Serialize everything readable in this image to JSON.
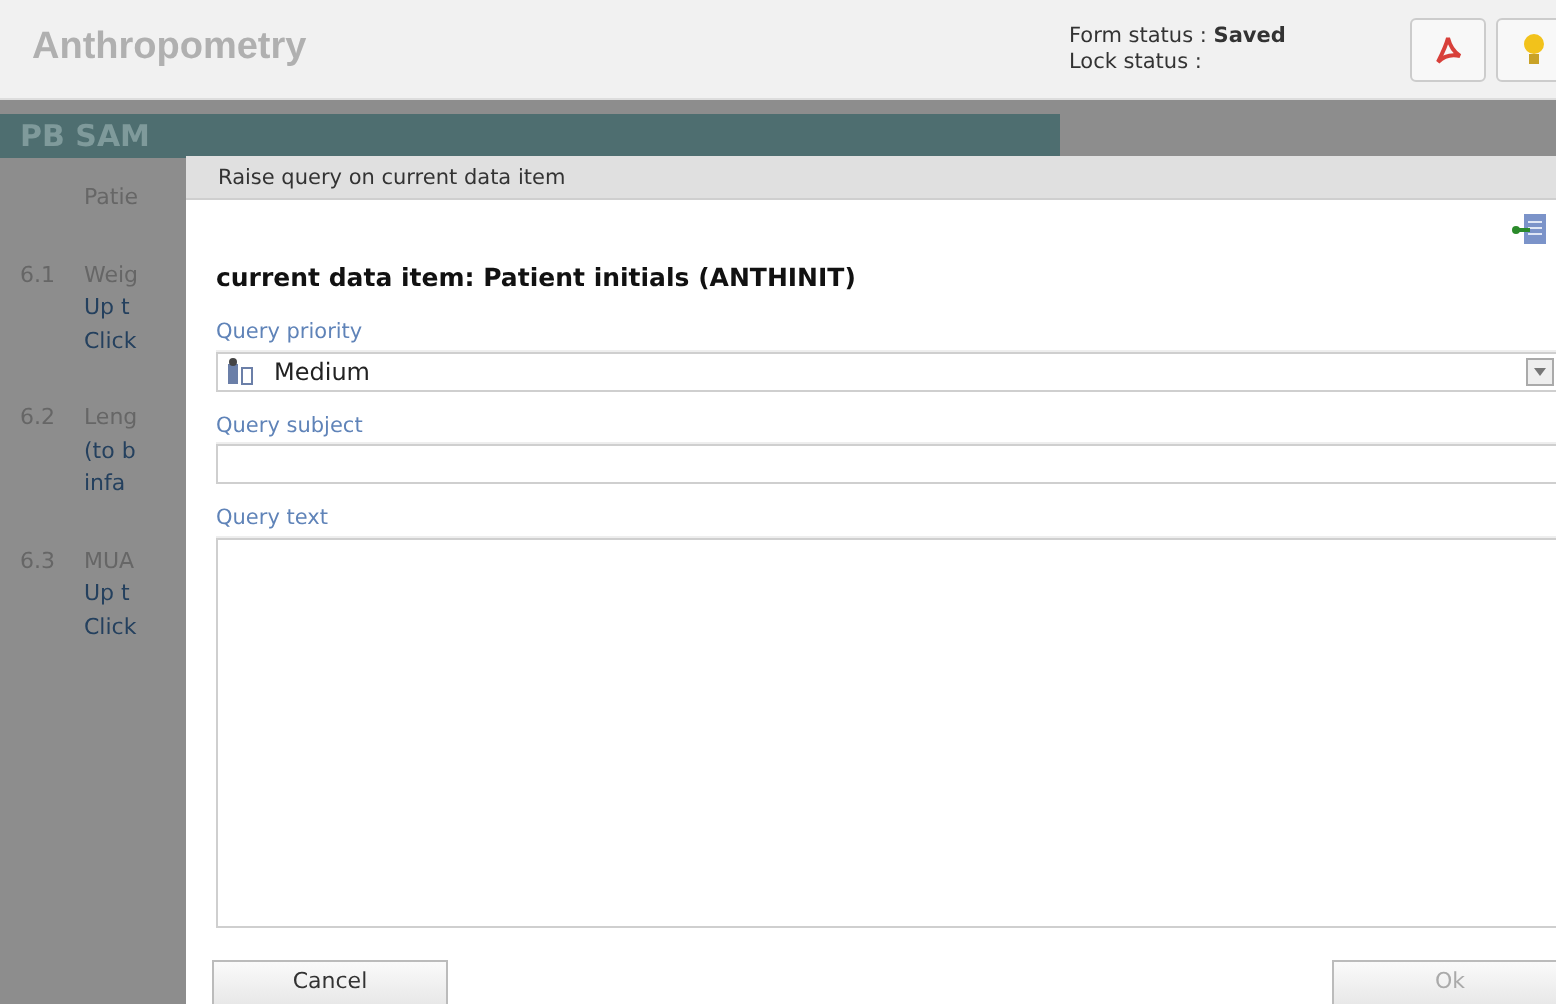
{
  "header": {
    "title": "Anthropometry",
    "form_status_label": "Form status :",
    "form_status_value": "Saved",
    "lock_status_label": "Lock status :"
  },
  "background": {
    "banner": "PB SAM",
    "rows": [
      {
        "number": "",
        "label": "Patie",
        "sublines": []
      },
      {
        "number": "6.1",
        "label": "Weig",
        "sublines": [
          "Up t",
          "Click"
        ]
      },
      {
        "number": "6.2",
        "label": "Leng",
        "sublines": [
          "(to b",
          "infa"
        ]
      },
      {
        "number": "6.3",
        "label": "MUA",
        "sublines": [
          "Up t",
          "Click"
        ]
      }
    ]
  },
  "dialog": {
    "title": "Raise query on current data item",
    "heading": "current data item: Patient initials (ANTHINIT)",
    "fields": [
      {
        "kind": "select",
        "label": "Query priority",
        "value": "Medium"
      },
      {
        "kind": "input",
        "label": "Query subject"
      },
      {
        "kind": "textarea",
        "label": "Query text"
      }
    ],
    "buttons": [
      "Cancel",
      "Ok"
    ]
  }
}
